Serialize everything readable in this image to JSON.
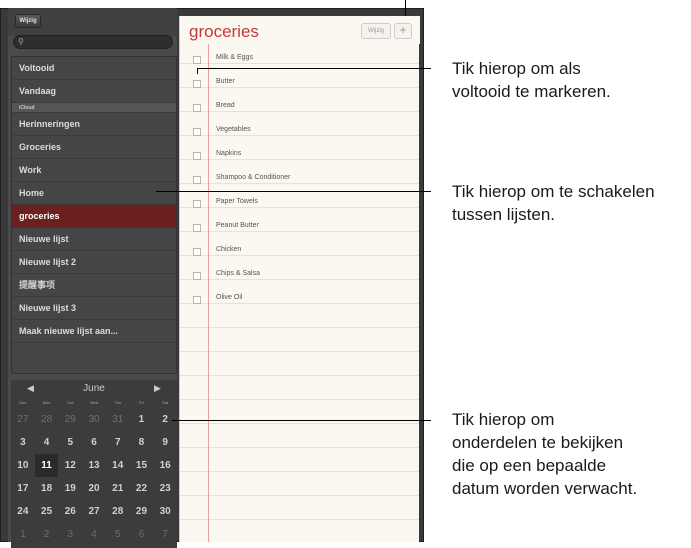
{
  "sidebar": {
    "edit_label": "Wijzig",
    "lists": [
      {
        "label": "Voltooid"
      },
      {
        "label": "Vandaag"
      },
      {
        "label": "iCloud"
      },
      {
        "label": "Herinneringen"
      },
      {
        "label": "Groceries"
      },
      {
        "label": "Work"
      },
      {
        "label": "Home"
      },
      {
        "label": "groceries"
      },
      {
        "label": "Nieuwe lijst"
      },
      {
        "label": "Nieuwe lijst 2"
      },
      {
        "label": "提醒事项"
      },
      {
        "label": "Nieuwe lijst 3"
      },
      {
        "label": "Maak nieuwe lijst aan..."
      }
    ]
  },
  "calendar": {
    "month": "June",
    "weekdays": [
      "Sun",
      "Mon",
      "Tue",
      "Wed",
      "Thu",
      "Fri",
      "Sat"
    ],
    "weeks": [
      [
        "27",
        "28",
        "29",
        "30",
        "31",
        "1",
        "2"
      ],
      [
        "3",
        "4",
        "5",
        "6",
        "7",
        "8",
        "9"
      ],
      [
        "10",
        "11",
        "12",
        "13",
        "14",
        "15",
        "16"
      ],
      [
        "17",
        "18",
        "19",
        "20",
        "21",
        "22",
        "23"
      ],
      [
        "24",
        "25",
        "26",
        "27",
        "28",
        "29",
        "30"
      ],
      [
        "1",
        "2",
        "3",
        "4",
        "5",
        "6",
        "7"
      ]
    ],
    "today": "11"
  },
  "list": {
    "title": "groceries",
    "edit_label": "Wijzig",
    "add_label": "+",
    "items": [
      "Milk & Eggs",
      "Butter",
      "Bread",
      "Vegetables",
      "Napkins",
      "Shampoo & Conditioner",
      "Paper Towels",
      "Peanut Butter",
      "Chicken",
      "Chips & Salsa",
      "Olive Oil"
    ]
  },
  "callouts": {
    "mark_complete": [
      "Tik hierop om als",
      "voltooid te markeren."
    ],
    "switch_lists": [
      "Tik hierop om te schakelen",
      "tussen lijsten."
    ],
    "view_by_date": [
      "Tik hierop om",
      "onderdelen te bekijken",
      "die op een bepaalde",
      "datum worden verwacht."
    ]
  }
}
